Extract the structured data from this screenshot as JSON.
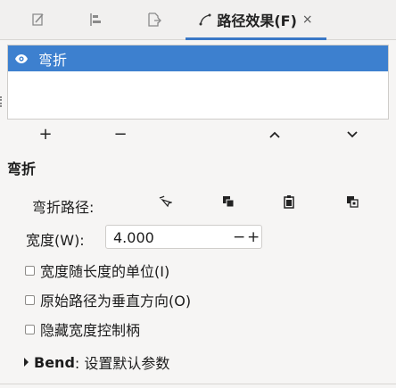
{
  "tabs": [
    {
      "icon": "fill-stroke-icon"
    },
    {
      "icon": "align-icon"
    },
    {
      "icon": "export-icon"
    },
    {
      "icon": "path-effect-icon",
      "label": "路径效果(F)",
      "close": "×"
    }
  ],
  "effects_list": {
    "items": [
      {
        "label": "弯折",
        "visible_icon": "eye-icon",
        "selected": true
      }
    ]
  },
  "list_buttons": {
    "add": "+",
    "remove": "−",
    "up": "up-chevron-icon",
    "down": "down-chevron-icon"
  },
  "effect": {
    "title": "弯折",
    "bend_path_label": "弯折路径:",
    "bend_path_tools": [
      "edit-on-canvas-icon",
      "copy-icon",
      "paste-icon",
      "link-icon"
    ],
    "width_label": "宽度(W):",
    "width_value": "4.000",
    "width_minus": "−",
    "width_plus": "+",
    "checkboxes": [
      {
        "label": "宽度随长度的单位(I)",
        "checked": false
      },
      {
        "label": "原始路径为垂直方向(O)",
        "checked": false
      },
      {
        "label": "隐藏宽度控制柄",
        "checked": false
      }
    ],
    "defaults_prefix": "Bend",
    "defaults_suffix": ": 设置默认参数"
  },
  "colors": {
    "accent": "#3d80cf",
    "tab_underline": "#3a78c6"
  }
}
